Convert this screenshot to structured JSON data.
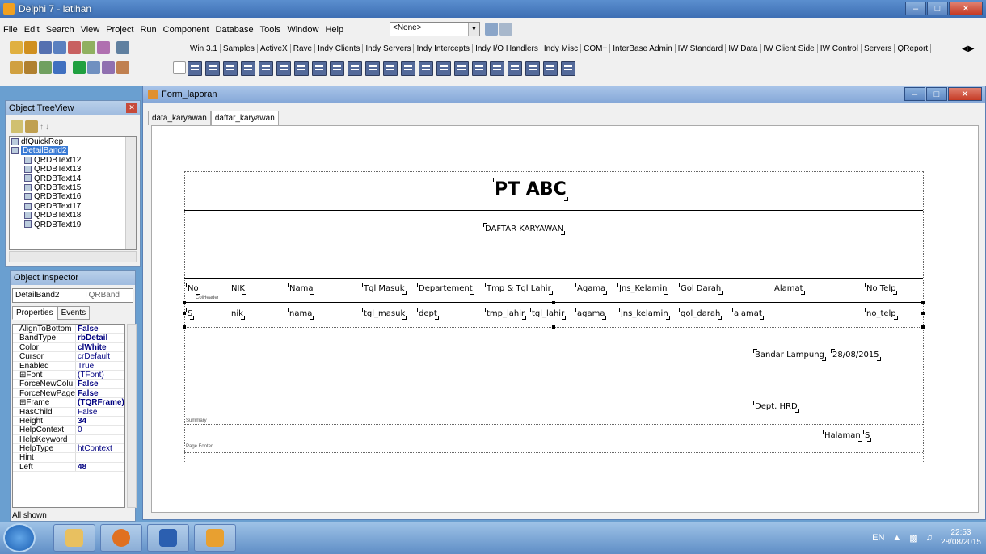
{
  "app": {
    "title": "Delphi 7 - latihan"
  },
  "menu": [
    "File",
    "Edit",
    "Search",
    "View",
    "Project",
    "Run",
    "Component",
    "Database",
    "Tools",
    "Window",
    "Help"
  ],
  "config_combo": "<None>",
  "palette_tabs": [
    "Win 3.1",
    "Samples",
    "ActiveX",
    "Rave",
    "Indy Clients",
    "Indy Servers",
    "Indy Intercepts",
    "Indy I/O Handlers",
    "Indy Misc",
    "COM+",
    "InterBase Admin",
    "IW Standard",
    "IW Data",
    "IW Client Side",
    "IW Control",
    "Servers",
    "QReport"
  ],
  "treeview": {
    "title": "Object TreeView",
    "nodes": [
      {
        "label": "dfQuickRep",
        "level": 0,
        "selected": false
      },
      {
        "label": "DetailBand2",
        "level": 0,
        "selected": true
      },
      {
        "label": "QRDBText12",
        "level": 1,
        "selected": false
      },
      {
        "label": "QRDBText13",
        "level": 1,
        "selected": false
      },
      {
        "label": "QRDBText14",
        "level": 1,
        "selected": false
      },
      {
        "label": "QRDBText15",
        "level": 1,
        "selected": false
      },
      {
        "label": "QRDBText16",
        "level": 1,
        "selected": false
      },
      {
        "label": "QRDBText17",
        "level": 1,
        "selected": false
      },
      {
        "label": "QRDBText18",
        "level": 1,
        "selected": false
      },
      {
        "label": "QRDBText19",
        "level": 1,
        "selected": false
      }
    ]
  },
  "inspector": {
    "title": "Object Inspector",
    "object_name": "DetailBand2",
    "object_type": "TQRBand",
    "tabs": [
      "Properties",
      "Events"
    ],
    "properties": [
      {
        "name": "AlignToBottom",
        "value": "False",
        "bold": true
      },
      {
        "name": "BandType",
        "value": "rbDetail",
        "bold": true
      },
      {
        "name": "Color",
        "value": "clWhite",
        "bold": true
      },
      {
        "name": "Cursor",
        "value": "crDefault",
        "bold": false
      },
      {
        "name": "Enabled",
        "value": "True",
        "bold": false
      },
      {
        "name": "⊞Font",
        "value": "(TFont)",
        "bold": false
      },
      {
        "name": "ForceNewColu",
        "value": "False",
        "bold": true
      },
      {
        "name": "ForceNewPage",
        "value": "False",
        "bold": true
      },
      {
        "name": "⊞Frame",
        "value": "(TQRFrame)",
        "bold": true
      },
      {
        "name": "HasChild",
        "value": "False",
        "bold": false
      },
      {
        "name": "Height",
        "value": "34",
        "bold": true
      },
      {
        "name": "HelpContext",
        "value": "0",
        "bold": false
      },
      {
        "name": "HelpKeyword",
        "value": "",
        "bold": false
      },
      {
        "name": "HelpType",
        "value": "htContext",
        "bold": false
      },
      {
        "name": "Hint",
        "value": "",
        "bold": false
      },
      {
        "name": "Left",
        "value": "48",
        "bold": true
      }
    ],
    "footer": "All shown"
  },
  "form": {
    "title": "Form_laporan",
    "tabs": [
      "data_karyawan",
      "daftar_karyawan"
    ],
    "active_tab": 1
  },
  "report": {
    "company": "PT ABC",
    "subtitle": "DAFTAR KARYAWAN",
    "band_header_label": "ColHeader",
    "headers": [
      "No",
      "NIK",
      "Nama",
      "Tgl Masuk",
      "Departement",
      "Tmp & Tgl Lahir",
      "Agama",
      "Jns_Kelamin",
      "Gol Darah",
      "Alamat",
      "No Telp"
    ],
    "fields": [
      "S",
      "nik",
      "nama",
      "tgl_masuk",
      "dept",
      "tmp_lahir",
      "tgl_lahir",
      "agama",
      "jns_kelamin",
      "gol_darah",
      "alamat",
      "no_telp"
    ],
    "city_date": "Bandar Lampung",
    "date": "28/08/2015",
    "dept": "Dept. HRD",
    "summary_label": "Summary",
    "halaman": "Halaman",
    "page_no": "S",
    "footer_label": "Page Footer"
  },
  "taskbar": {
    "lang": "EN",
    "time": "22:53",
    "date": "28/08/2015"
  }
}
